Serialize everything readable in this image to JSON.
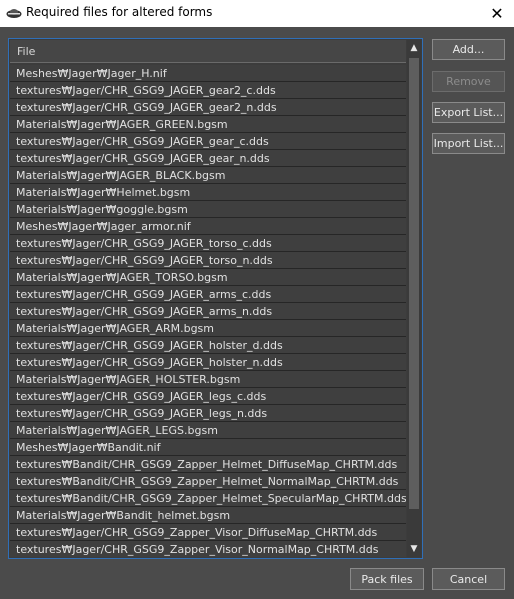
{
  "window": {
    "title": "Required files for altered forms",
    "close": "✕"
  },
  "list": {
    "header": "File",
    "files": [
      "Meshes₩Jager₩Jager_H.nif",
      "textures₩Jager/CHR_GSG9_JAGER_gear2_c.dds",
      "textures₩Jager/CHR_GSG9_JAGER_gear2_n.dds",
      "Materials₩Jager₩JAGER_GREEN.bgsm",
      "textures₩Jager/CHR_GSG9_JAGER_gear_c.dds",
      "textures₩Jager/CHR_GSG9_JAGER_gear_n.dds",
      "Materials₩Jager₩JAGER_BLACK.bgsm",
      "Materials₩Jager₩Helmet.bgsm",
      "Materials₩Jager₩goggle.bgsm",
      "Meshes₩Jager₩Jager_armor.nif",
      "textures₩Jager/CHR_GSG9_JAGER_torso_c.dds",
      "textures₩Jager/CHR_GSG9_JAGER_torso_n.dds",
      "Materials₩Jager₩JAGER_TORSO.bgsm",
      "textures₩Jager/CHR_GSG9_JAGER_arms_c.dds",
      "textures₩Jager/CHR_GSG9_JAGER_arms_n.dds",
      "Materials₩Jager₩JAGER_ARM.bgsm",
      "textures₩Jager/CHR_GSG9_JAGER_holster_d.dds",
      "textures₩Jager/CHR_GSG9_JAGER_holster_n.dds",
      "Materials₩Jager₩JAGER_HOLSTER.bgsm",
      "textures₩Jager/CHR_GSG9_JAGER_legs_c.dds",
      "textures₩Jager/CHR_GSG9_JAGER_legs_n.dds",
      "Materials₩Jager₩JAGER_LEGS.bgsm",
      "Meshes₩Jager₩Bandit.nif",
      "textures₩Bandit/CHR_GSG9_Zapper_Helmet_DiffuseMap_CHRTM.dds",
      "textures₩Bandit/CHR_GSG9_Zapper_Helmet_NormalMap_CHRTM.dds",
      "textures₩Bandit/CHR_GSG9_Zapper_Helmet_SpecularMap_CHRTM.dds",
      "Materials₩Jager₩Bandit_helmet.bgsm",
      "textures₩Jager/CHR_GSG9_Zapper_Visor_DiffuseMap_CHRTM.dds",
      "textures₩Jager/CHR_GSG9_Zapper_Visor_NormalMap_CHRTM.dds"
    ],
    "scroll_up": "▲",
    "scroll_down": "▼"
  },
  "buttons": {
    "add": "Add...",
    "remove": "Remove",
    "export": "Export List...",
    "import": "Import List...",
    "pack": "Pack files",
    "cancel": "Cancel"
  }
}
